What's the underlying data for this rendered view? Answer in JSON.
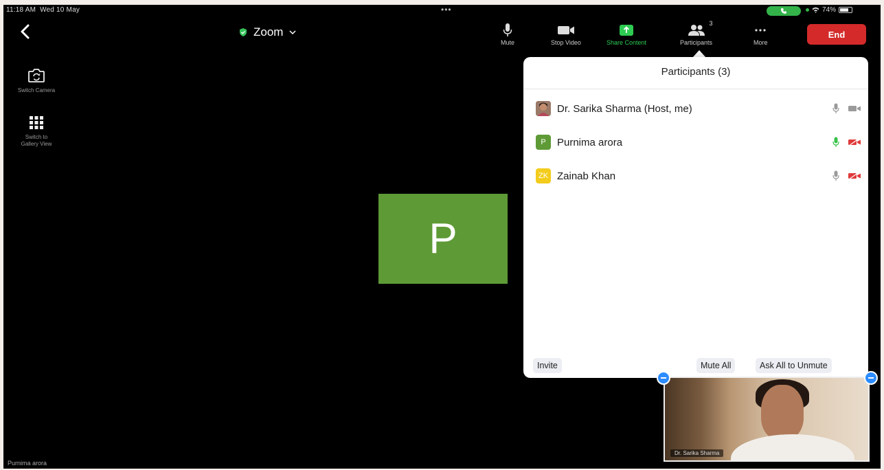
{
  "status_bar": {
    "time": "11:18 AM",
    "date": "Wed 10 May",
    "battery": "74%"
  },
  "header": {
    "meeting_title": "Zoom",
    "tools": {
      "mute": "Mute",
      "stop_video": "Stop Video",
      "share_content": "Share Content",
      "participants": "Participants",
      "participants_count": "3",
      "more": "More"
    },
    "end_label": "End"
  },
  "side_controls": {
    "switch_camera": "Switch Camera",
    "gallery_view": "Switch to\nGallery View"
  },
  "speaker": {
    "initial": "P",
    "name": "Purnima arora"
  },
  "participants_panel": {
    "title": "Participants (3)",
    "participants": [
      {
        "name": "Dr. Sarika Sharma (Host, me)",
        "initials": "",
        "avatar_color": "#8a5a48",
        "mic": "off",
        "video": "on"
      },
      {
        "name": "Purnima arora",
        "initials": "P",
        "avatar_color": "#5e9a36",
        "mic": "active",
        "video": "off"
      },
      {
        "name": "Zainab Khan",
        "initials": "ZK",
        "avatar_color": "#f3cc1c",
        "mic": "off",
        "video": "off"
      }
    ],
    "invite_label": "Invite",
    "mute_all_label": "Mute All",
    "ask_unmute_label": "Ask All to Unmute"
  },
  "self_view": {
    "name": "Dr. Sarika Sharma"
  },
  "colors": {
    "end_red": "#d42a2a",
    "share_green": "#2ecc52",
    "accent_blue": "#2d8cff"
  }
}
